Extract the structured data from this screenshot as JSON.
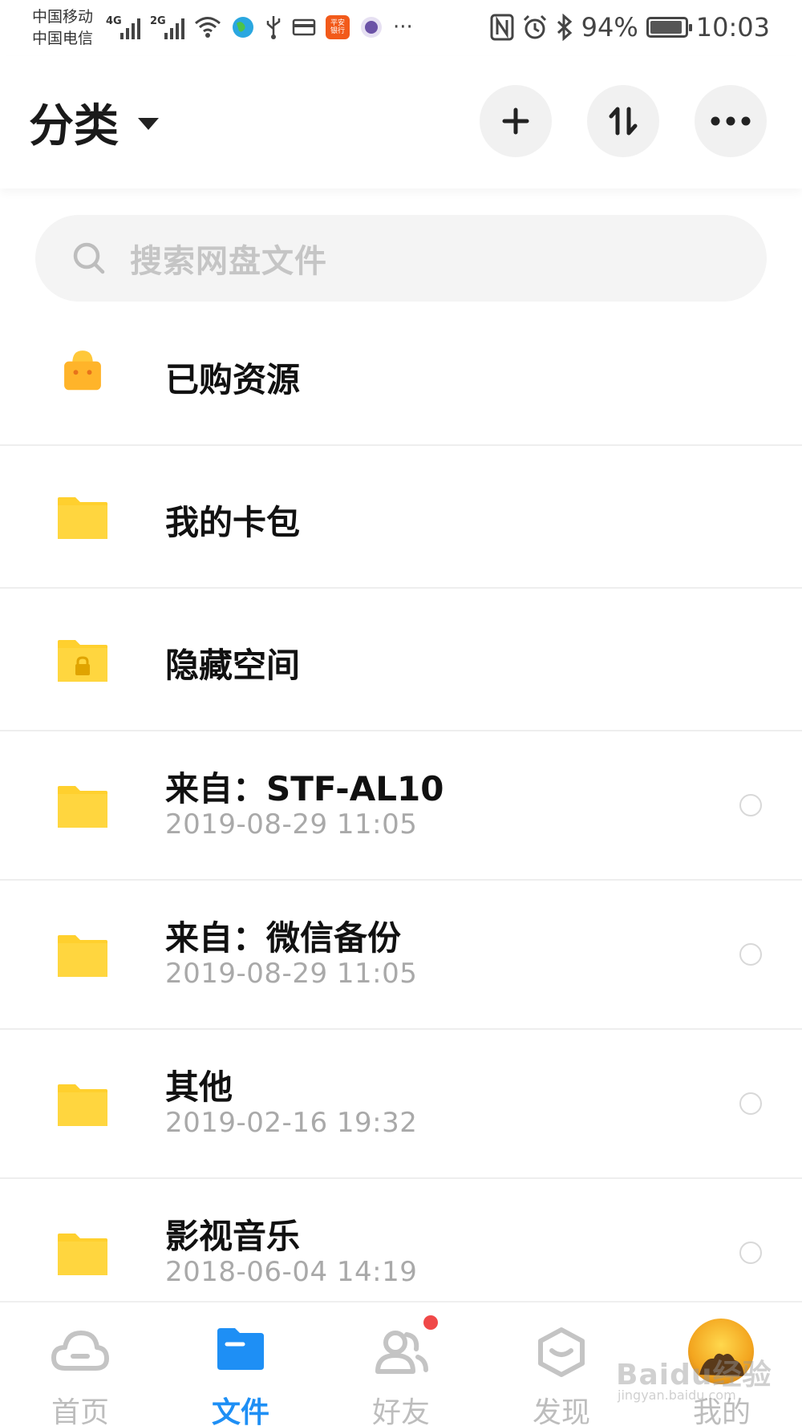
{
  "status_bar": {
    "carrier_1": "中国移动",
    "carrier_2": "中国电信",
    "net_1": "4G",
    "net_2": "2G",
    "app_badge": "平安银行",
    "overflow": "···",
    "battery": "94%",
    "battery_level": 0.94,
    "time": "10:03"
  },
  "header": {
    "title": "分类"
  },
  "search": {
    "placeholder": "搜索网盘文件"
  },
  "files": [
    {
      "name": "已购资源",
      "date": "",
      "icon": "shopping-bag-icon"
    },
    {
      "name": "我的卡包",
      "date": "",
      "icon": "folder-icon"
    },
    {
      "name": "隐藏空间",
      "date": "",
      "icon": "locked-folder-icon"
    },
    {
      "name": "来自：STF-AL10",
      "date": "2019-08-29   11:05",
      "icon": "folder-icon"
    },
    {
      "name": "来自：微信备份",
      "date": "2019-08-29   11:05",
      "icon": "folder-icon"
    },
    {
      "name": "其他",
      "date": "2019-02-16   19:32",
      "icon": "folder-icon"
    },
    {
      "name": "影视音乐",
      "date": "2018-06-04   14:19",
      "icon": "folder-icon"
    }
  ],
  "nav": {
    "tabs": [
      {
        "label": "首页",
        "icon": "cloud-icon",
        "active": false
      },
      {
        "label": "文件",
        "icon": "folder-icon",
        "active": true
      },
      {
        "label": "好友",
        "icon": "friends-icon",
        "active": false
      },
      {
        "label": "发现",
        "icon": "discover-icon",
        "active": false
      },
      {
        "label": "我的",
        "icon": "avatar",
        "active": false
      }
    ]
  },
  "watermark": {
    "text": "Baidu经验",
    "sub": "jingyan.baidu.com"
  },
  "colors": {
    "accent": "#1e8ff5",
    "folder": "#ffd02e",
    "bag": "#ffb42a",
    "notification": "#f04848"
  }
}
